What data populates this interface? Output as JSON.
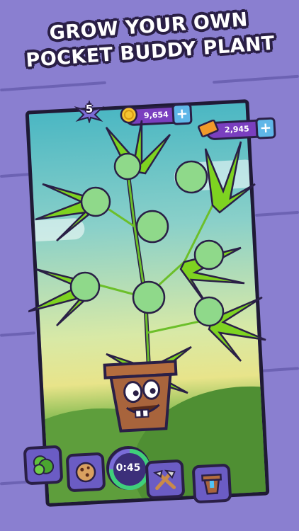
{
  "headline": {
    "line1": "GROW YOUR OWN",
    "line2": "POCKET BUDDY PLANT"
  },
  "hud": {
    "level": "5",
    "coins": "9,654",
    "tickets": "2,945",
    "plus_label": "+"
  },
  "toolbar": {
    "timer": "0:45",
    "timer_progress": 0.75,
    "items": [
      {
        "icon": "bud-icon"
      },
      {
        "icon": "cookie-icon"
      },
      {
        "icon": "tools-icon"
      },
      {
        "icon": "pot-icon"
      }
    ]
  },
  "colors": {
    "background": "#8a7fd0",
    "frame": "#1f1a35",
    "pill": "#7a3fbf",
    "plus_button": "#5fb7e8",
    "leaf": "#7ed321",
    "bud": "#8fd98a",
    "pot": "#a8643c"
  }
}
